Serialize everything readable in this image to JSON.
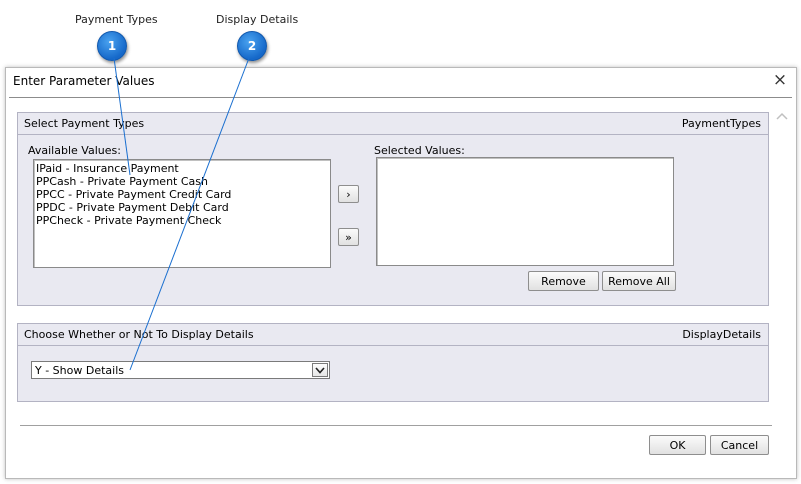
{
  "annotations": [
    {
      "number": "1",
      "label": "Payment Types"
    },
    {
      "number": "2",
      "label": "Display Details"
    }
  ],
  "dialog": {
    "title": "Enter Parameter Values",
    "close_icon": "×",
    "payment_group": {
      "title": "Select Payment Types",
      "param_name": "PaymentTypes",
      "available_label": "Available Values:",
      "selected_label": "Selected Values:",
      "available_values": [
        "IPaid - Insurance Payment",
        "PPCash - Private Payment Cash",
        "PPCC - Private Payment Credit Card",
        "PPDC - Private Payment Debit Card",
        "PPCheck - Private Payment Check"
      ],
      "selected_values": [],
      "add_icon": "›",
      "add_all_icon": "»",
      "remove_label": "Remove",
      "remove_all_label": "Remove All"
    },
    "details_group": {
      "title": "Choose Whether or Not To Display Details",
      "param_name": "DisplayDetails",
      "selected_value": "Y - Show Details"
    },
    "ok_label": "OK",
    "cancel_label": "Cancel"
  }
}
